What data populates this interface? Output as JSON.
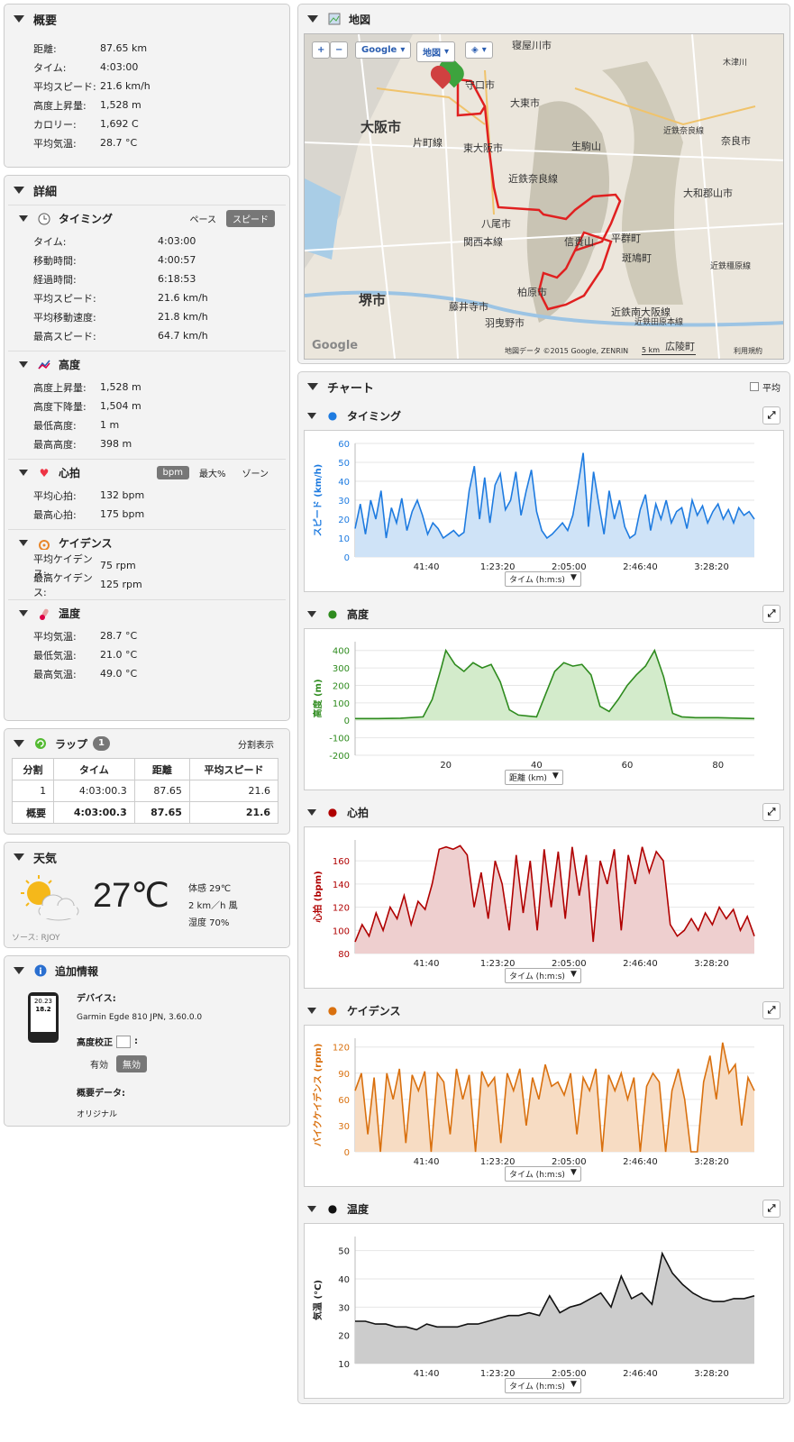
{
  "summary": {
    "title": "概要",
    "rows": [
      {
        "k": "距離:",
        "v": "87.65 km"
      },
      {
        "k": "タイム:",
        "v": "4:03:00"
      },
      {
        "k": "平均スピード:",
        "v": "21.6 km/h"
      },
      {
        "k": "高度上昇量:",
        "v": "1,528 m"
      },
      {
        "k": "カロリー:",
        "v": "1,692 C"
      },
      {
        "k": "平均気温:",
        "v": "28.7 °C"
      }
    ]
  },
  "details": {
    "title": "詳細",
    "timing": {
      "title": "タイミング",
      "opt1": "ペース",
      "opt2": "スピード",
      "rows": [
        {
          "k": "タイム:",
          "v": "4:03:00"
        },
        {
          "k": "移動時間:",
          "v": "4:00:57"
        },
        {
          "k": "経過時間:",
          "v": "6:18:53"
        },
        {
          "k": "平均スピード:",
          "v": "21.6 km/h"
        },
        {
          "k": "平均移動速度:",
          "v": "21.8 km/h"
        },
        {
          "k": "最高スピード:",
          "v": "64.7 km/h"
        }
      ]
    },
    "elevation": {
      "title": "高度",
      "rows": [
        {
          "k": "高度上昇量:",
          "v": "1,528 m"
        },
        {
          "k": "高度下降量:",
          "v": "1,504 m"
        },
        {
          "k": "最低高度:",
          "v": "1 m"
        },
        {
          "k": "最高高度:",
          "v": "398 m"
        }
      ]
    },
    "heart": {
      "title": "心拍",
      "opt1": "bpm",
      "opt2": "最大%",
      "opt3": "ゾーン",
      "rows": [
        {
          "k": "平均心拍:",
          "v": "132 bpm"
        },
        {
          "k": "最高心拍:",
          "v": "175 bpm"
        }
      ]
    },
    "cadence": {
      "title": "ケイデンス",
      "rows": [
        {
          "k": "平均ケイデンス:",
          "v": "75 rpm"
        },
        {
          "k": "最高ケイデンス:",
          "v": "125 rpm"
        }
      ]
    },
    "temperature": {
      "title": "温度",
      "rows": [
        {
          "k": "平均気温:",
          "v": "28.7 °C"
        },
        {
          "k": "最低気温:",
          "v": "21.0 °C"
        },
        {
          "k": "最高気温:",
          "v": "49.0 °C"
        }
      ]
    }
  },
  "laps": {
    "title": "ラップ",
    "count": "1",
    "split": "分割表示",
    "headers": [
      "分割",
      "タイム",
      "距離",
      "平均スピード"
    ],
    "rows": [
      [
        "1",
        "4:03:00.3",
        "87.65",
        "21.6"
      ],
      [
        "概要",
        "4:03:00.3",
        "87.65",
        "21.6"
      ]
    ]
  },
  "weather": {
    "title": "天気",
    "temp": "27℃",
    "feels": "体感 29℃",
    "wind": "2 km／h 風",
    "humidity": "湿度 70%",
    "source": "ソース: RJOY"
  },
  "extra": {
    "title": "追加情報",
    "device_label": "デバイス:",
    "device": "Garmin Egde 810 JPN, 3.60.0.0",
    "calib_label": "高度校正",
    "calib_colon": ":",
    "calib_on": "有効",
    "calib_off": "無効",
    "summary_label": "概要データ:",
    "summary_value": "オリジナル",
    "device_screen_1": "20.23",
    "device_screen_2": "18.2"
  },
  "map": {
    "title": "地図",
    "zoom_in": "+",
    "zoom_out": "−",
    "btn_google": "Google",
    "btn_map": "地図",
    "labels": [
      "寝屋川市",
      "守口市",
      "大東市",
      "大阪市",
      "片町線",
      "東大阪市",
      "生駒山",
      "近鉄奈良線",
      "奈良市",
      "大和郡山市",
      "八尾市",
      "関西本線",
      "信貴山",
      "平群町",
      "斑鳩町",
      "堺市",
      "柏原市",
      "藤井寺市",
      "羽曳野市",
      "近鉄南大阪線",
      "広陵町",
      "木津川",
      "近鉄奈良線",
      "近鉄橿原線",
      "近鉄田原本線"
    ],
    "footer": "地図データ ©2015 Google, ZENRIN",
    "scale": "5 km",
    "terms": "利用規約",
    "logo": "Google"
  },
  "charts_panel": {
    "title": "チャート",
    "avg": "平均"
  },
  "chart_data": [
    {
      "type": "line",
      "title": "タイミング",
      "ylabel": "スピード (km/h)",
      "xlabel": "タイム (h:m:s)",
      "xticks": [
        "41:40",
        "1:23:20",
        "2:05:00",
        "2:46:40",
        "3:28:20"
      ],
      "yticks": [
        0,
        10,
        20,
        30,
        40,
        50,
        60
      ],
      "ylim": [
        0,
        60
      ],
      "color": "#1e7be0",
      "fill": "#cfe3f7",
      "values": [
        15,
        28,
        12,
        30,
        20,
        35,
        10,
        26,
        18,
        31,
        14,
        24,
        30,
        22,
        12,
        18,
        15,
        10,
        12,
        14,
        11,
        13,
        35,
        48,
        20,
        42,
        18,
        38,
        44,
        25,
        30,
        45,
        22,
        35,
        46,
        24,
        14,
        10,
        12,
        15,
        18,
        14,
        22,
        38,
        55,
        16,
        45,
        28,
        12,
        35,
        20,
        30,
        16,
        10,
        12,
        25,
        33,
        14,
        28,
        20,
        30,
        18,
        24,
        26,
        15,
        30,
        22,
        27,
        18,
        24,
        28,
        20,
        25,
        18,
        26,
        22,
        24,
        20
      ]
    },
    {
      "type": "area",
      "title": "高度",
      "ylabel": "高度 (m)",
      "xlabel": "距離 (km)",
      "xticks": [
        "20",
        "40",
        "60",
        "80"
      ],
      "yticks": [
        -200,
        -100,
        0,
        100,
        200,
        300,
        400
      ],
      "ylim": [
        -200,
        450
      ],
      "color": "#2e8b1e",
      "fill": "#d3ebcb",
      "x": [
        0,
        5,
        10,
        15,
        17,
        19,
        20,
        22,
        24,
        26,
        28,
        30,
        32,
        34,
        36,
        38,
        40,
        42,
        44,
        46,
        48,
        50,
        52,
        54,
        56,
        58,
        60,
        62,
        64,
        66,
        68,
        70,
        72,
        75,
        80,
        85,
        88
      ],
      "values": [
        10,
        10,
        12,
        20,
        120,
        300,
        400,
        320,
        280,
        330,
        300,
        320,
        220,
        60,
        30,
        25,
        20,
        150,
        280,
        330,
        310,
        320,
        260,
        80,
        50,
        120,
        200,
        260,
        310,
        400,
        250,
        40,
        20,
        15,
        15,
        12,
        10
      ]
    },
    {
      "type": "line",
      "title": "心拍",
      "ylabel": "心拍 (bpm)",
      "xlabel": "タイム (h:m:s)",
      "xticks": [
        "41:40",
        "1:23:20",
        "2:05:00",
        "2:46:40",
        "3:28:20"
      ],
      "yticks": [
        80,
        100,
        120,
        140,
        160
      ],
      "ylim": [
        80,
        178
      ],
      "color": "#b00000",
      "fill": "#eecfcf",
      "values": [
        90,
        105,
        95,
        115,
        100,
        120,
        110,
        130,
        105,
        125,
        118,
        140,
        170,
        172,
        170,
        173,
        165,
        120,
        150,
        110,
        160,
        140,
        100,
        165,
        115,
        160,
        100,
        170,
        120,
        168,
        110,
        172,
        130,
        165,
        90,
        160,
        140,
        170,
        100,
        165,
        140,
        172,
        150,
        168,
        160,
        105,
        95,
        100,
        110,
        100,
        115,
        105,
        120,
        110,
        118,
        100,
        112,
        95
      ]
    },
    {
      "type": "line",
      "title": "ケイデンス",
      "ylabel": "バイクケイデンス (rpm)",
      "xlabel": "タイム (h:m:s)",
      "xticks": [
        "41:40",
        "1:23:20",
        "2:05:00",
        "2:46:40",
        "3:28:20"
      ],
      "yticks": [
        0,
        30,
        60,
        90,
        120
      ],
      "ylim": [
        0,
        130
      ],
      "color": "#d9700e",
      "fill": "#f7dcc3",
      "values": [
        70,
        90,
        20,
        85,
        0,
        90,
        60,
        95,
        10,
        88,
        70,
        92,
        0,
        90,
        80,
        20,
        95,
        60,
        88,
        0,
        92,
        75,
        85,
        10,
        90,
        70,
        95,
        30,
        85,
        60,
        100,
        75,
        80,
        65,
        90,
        20,
        85,
        70,
        95,
        0,
        88,
        70,
        90,
        60,
        85,
        0,
        75,
        90,
        80,
        0,
        70,
        95,
        60,
        0,
        0,
        80,
        110,
        60,
        125,
        90,
        100,
        30,
        85,
        70
      ]
    },
    {
      "type": "line",
      "title": "温度",
      "ylabel": "気温 (°C)",
      "xlabel": "タイム (h:m:s)",
      "xticks": [
        "41:40",
        "1:23:20",
        "2:05:00",
        "2:46:40",
        "3:28:20"
      ],
      "yticks": [
        10,
        20,
        30,
        40,
        50
      ],
      "ylim": [
        10,
        55
      ],
      "color": "#111111",
      "fill": "#cccccc",
      "values": [
        25,
        25,
        24,
        24,
        23,
        23,
        22,
        24,
        23,
        23,
        23,
        24,
        24,
        25,
        26,
        27,
        27,
        28,
        27,
        34,
        28,
        30,
        31,
        33,
        35,
        30,
        41,
        33,
        35,
        31,
        49,
        42,
        38,
        35,
        33,
        32,
        32,
        33,
        33,
        34
      ]
    }
  ]
}
